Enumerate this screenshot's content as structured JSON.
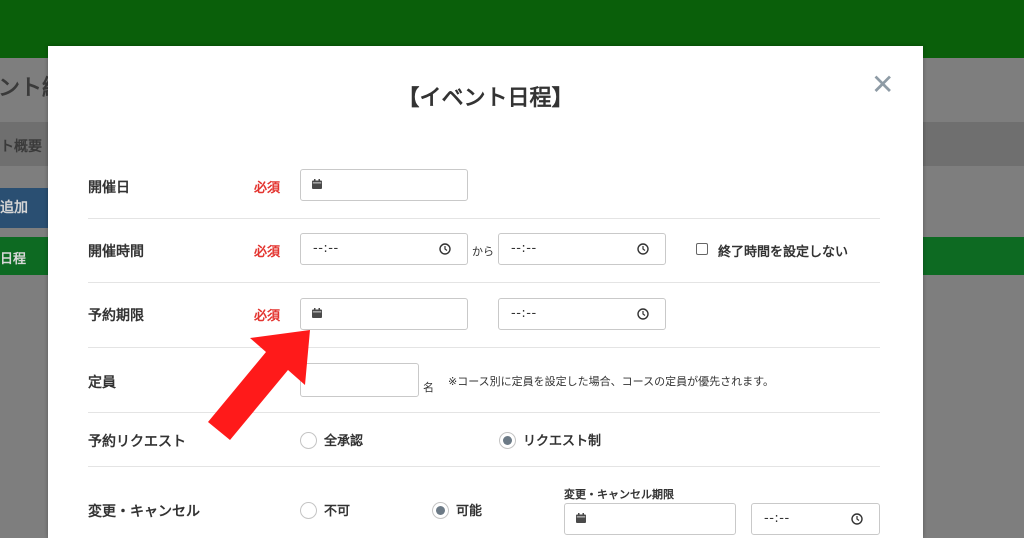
{
  "background": {
    "page_title_partial": "ント編",
    "tab_partial": "ト概要",
    "add_button_partial": "追加",
    "green_bar_partial": "日程"
  },
  "modal": {
    "title": "【イベント日程】",
    "close_icon": "close-icon",
    "rows": {
      "date": {
        "label": "開催日",
        "required": "必須"
      },
      "time": {
        "label": "開催時間",
        "required": "必須",
        "start_value": "--:--",
        "separator": "から",
        "end_value": "--:--",
        "no_end_checkbox": "終了時間を設定しない"
      },
      "deadline": {
        "label": "予約期限",
        "required": "必須",
        "time_value": "--:--"
      },
      "capacity": {
        "label": "定員",
        "unit": "名",
        "note": "※コース別に定員を設定した場合、コースの定員が優先されます。"
      },
      "request": {
        "label": "予約リクエスト",
        "option_all": "全承認",
        "option_request": "リクエスト制",
        "selected": "リクエスト制"
      },
      "cancel": {
        "label": "変更・キャンセル",
        "option_no": "不可",
        "option_yes": "可能",
        "selected": "可能",
        "deadline_label": "変更・キャンセル期限",
        "deadline_time": "--:--"
      }
    }
  },
  "colors": {
    "header_green": "#0a5f0a",
    "required_red": "#e3342f",
    "arrow_red": "#ff1a1a"
  }
}
